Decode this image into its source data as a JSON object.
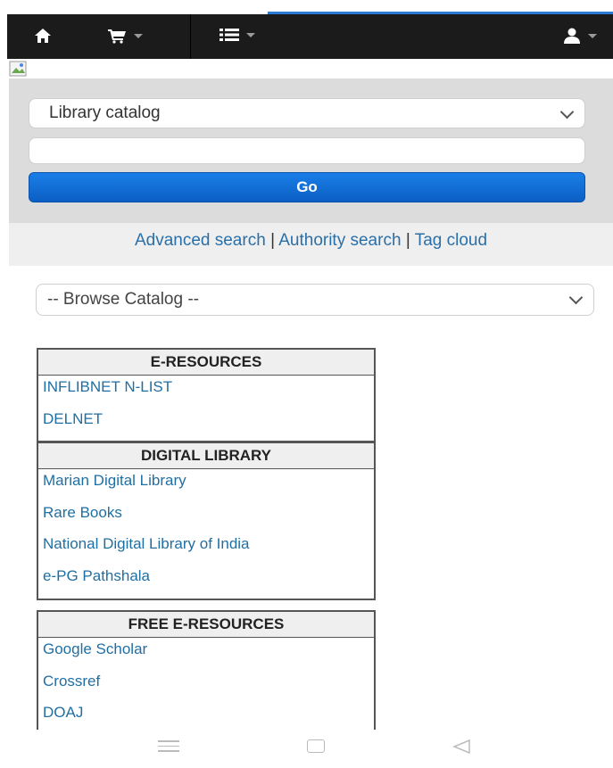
{
  "navbar": {
    "home_icon": "home-icon",
    "cart_icon": "cart-icon",
    "list_icon": "list-icon",
    "user_icon": "user-icon"
  },
  "search": {
    "catalog_select": "Library catalog",
    "query_value": "",
    "go_label": "Go"
  },
  "links": {
    "advanced": "Advanced search",
    "authority": "Authority search",
    "tagcloud": "Tag cloud",
    "sep": "|"
  },
  "browse": {
    "label": "-- Browse Catalog --"
  },
  "e_resources": {
    "title": "E-RESOURCES",
    "items": [
      "INFLIBNET N-LIST",
      "DELNET"
    ]
  },
  "digital_library": {
    "title": "DIGITAL LIBRARY",
    "items": [
      "Marian Digital Library",
      "Rare Books",
      "National Digital Library of India",
      "e-PG Pathshala"
    ]
  },
  "free_resources": {
    "title": "FREE E-RESOURCES",
    "items": [
      "Google Scholar",
      "Crossref",
      "DOAJ"
    ]
  },
  "colors": {
    "navbar": "#1b1b1b",
    "link": "#1f6fa3",
    "go_button": "#0b6fd8",
    "progress": "#2b7bd6"
  }
}
